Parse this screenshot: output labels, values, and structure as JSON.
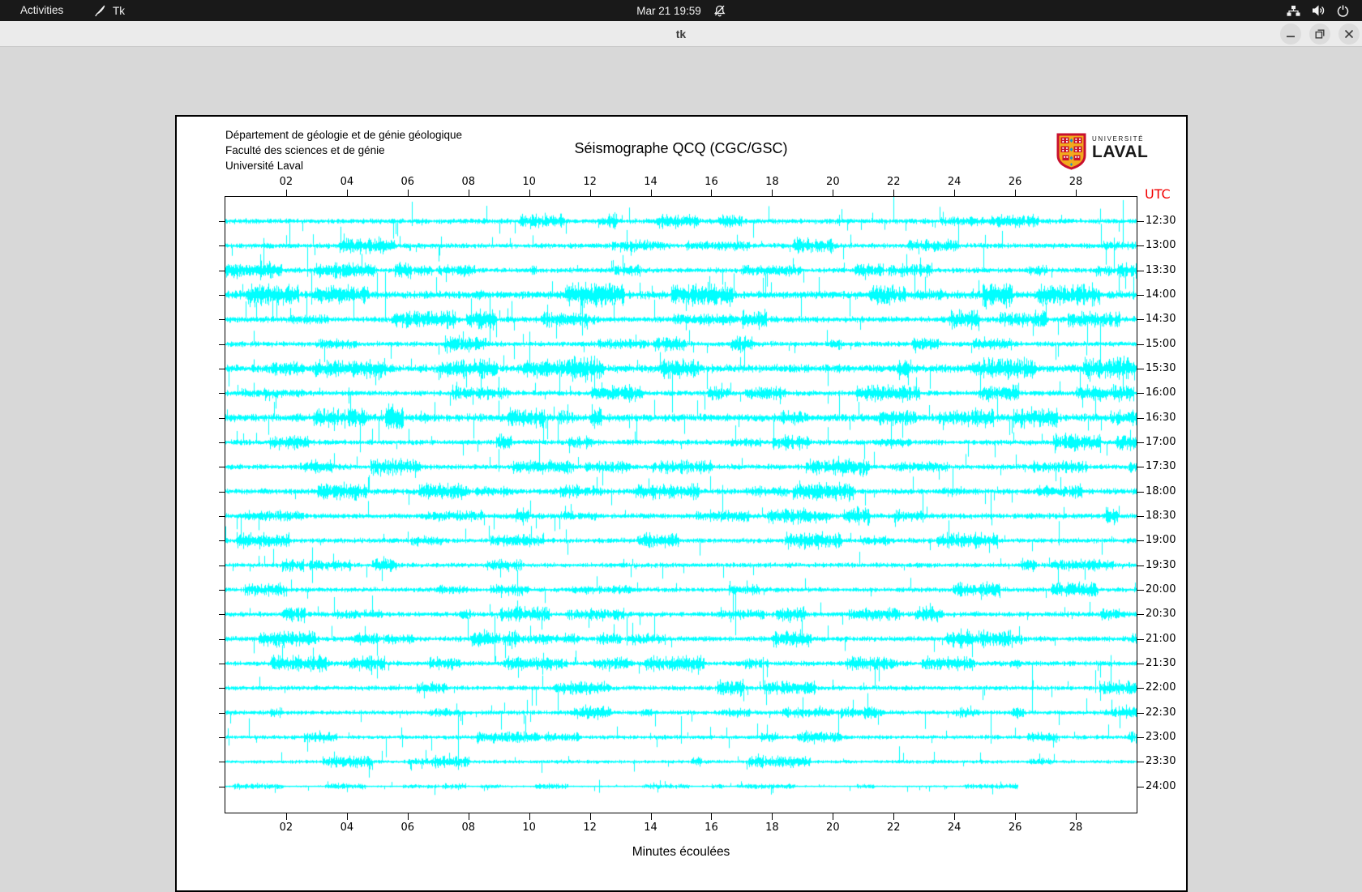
{
  "topbar": {
    "activities_label": "Activities",
    "app_name": "Tk",
    "clock": "Mar 21 19:59"
  },
  "window": {
    "title": "tk"
  },
  "header": {
    "org_lines": [
      "Département de géologie et de génie géologique",
      "Faculté des sciences et de génie",
      "Université Laval"
    ],
    "logo": {
      "top_text": "UNIVERSITÉ",
      "bottom_text": "LAVAL",
      "shield_red": "#c8102e",
      "shield_gold": "#f2aa1d",
      "shield_blue": "#1f8fcd"
    }
  },
  "chart_data": {
    "type": "line",
    "subtype": "seismogram-helicorder",
    "title": "Séismographe QCQ (CGC/GSC)",
    "xlabel": "Minutes écoulées",
    "x_tick_labels": [
      "02",
      "04",
      "06",
      "08",
      "10",
      "12",
      "14",
      "16",
      "18",
      "20",
      "22",
      "24",
      "26",
      "28"
    ],
    "x_range_minutes": [
      0,
      30
    ],
    "right_axis_title": "UTC",
    "right_axis_title_color": "#f20000",
    "trace_color": "#00ffff",
    "frame_color": "#000000",
    "rows": [
      {
        "utc": "12:30",
        "seed": 11,
        "amp": 1.0,
        "end": 1.0,
        "events": [
          {
            "x": 0.205,
            "up": 24,
            "down": 6
          },
          {
            "x": 0.985,
            "up": 26,
            "down": 26
          }
        ]
      },
      {
        "utc": "13:00",
        "seed": 12,
        "amp": 1.0,
        "end": 1.0,
        "events": [
          {
            "x": 0.975,
            "up": 10,
            "down": 34
          }
        ]
      },
      {
        "utc": "13:30",
        "seed": 13,
        "amp": 0.95,
        "end": 1.0,
        "events": [
          {
            "x": 0.09,
            "up": 30,
            "down": 8
          }
        ]
      },
      {
        "utc": "14:00",
        "seed": 14,
        "amp": 1.5,
        "end": 1.0,
        "events": [
          {
            "x": 0.175,
            "up": 28,
            "down": 28
          }
        ]
      },
      {
        "utc": "14:30",
        "seed": 15,
        "amp": 1.15,
        "end": 1.0,
        "events": [
          {
            "x": 0.27,
            "up": 26,
            "down": 10
          }
        ]
      },
      {
        "utc": "15:00",
        "seed": 16,
        "amp": 1.0,
        "end": 1.0,
        "events": [
          {
            "x": 0.96,
            "up": 30,
            "down": 30
          }
        ]
      },
      {
        "utc": "15:30",
        "seed": 17,
        "amp": 1.5,
        "end": 1.0,
        "events": []
      },
      {
        "utc": "16:00",
        "seed": 18,
        "amp": 1.0,
        "end": 1.0,
        "events": [
          {
            "x": 0.49,
            "up": 24,
            "down": 24
          }
        ]
      },
      {
        "utc": "16:30",
        "seed": 19,
        "amp": 1.45,
        "end": 1.0,
        "events": []
      },
      {
        "utc": "17:00",
        "seed": 20,
        "amp": 1.0,
        "end": 1.0,
        "events": [
          {
            "x": 0.73,
            "up": 26,
            "down": 8
          }
        ]
      },
      {
        "utc": "17:30",
        "seed": 21,
        "amp": 1.0,
        "end": 1.0,
        "events": [
          {
            "x": 0.3,
            "up": 22,
            "down": 6
          }
        ]
      },
      {
        "utc": "18:00",
        "seed": 22,
        "amp": 1.1,
        "end": 1.0,
        "events": [
          {
            "x": 0.545,
            "up": 8,
            "down": 26
          }
        ]
      },
      {
        "utc": "18:30",
        "seed": 23,
        "amp": 1.05,
        "end": 1.0,
        "events": [
          {
            "x": 0.765,
            "up": 28,
            "down": 8
          }
        ]
      },
      {
        "utc": "19:00",
        "seed": 24,
        "amp": 0.95,
        "end": 1.0,
        "events": [
          {
            "x": 0.915,
            "up": 24,
            "down": 6
          }
        ]
      },
      {
        "utc": "19:30",
        "seed": 25,
        "amp": 0.9,
        "end": 1.0,
        "events": [
          {
            "x": 0.095,
            "up": 22,
            "down": 22
          }
        ]
      },
      {
        "utc": "20:00",
        "seed": 26,
        "amp": 0.9,
        "end": 1.0,
        "events": [
          {
            "x": 0.32,
            "up": 24,
            "down": 8
          }
        ]
      },
      {
        "utc": "20:30",
        "seed": 27,
        "amp": 1.0,
        "end": 1.0,
        "events": [
          {
            "x": 0.56,
            "up": 26,
            "down": 26
          }
        ]
      },
      {
        "utc": "21:00",
        "seed": 28,
        "amp": 1.0,
        "end": 1.0,
        "events": [
          {
            "x": 0.295,
            "up": 28,
            "down": 28
          },
          {
            "x": 0.44,
            "up": 30,
            "down": 8
          }
        ]
      },
      {
        "utc": "21:30",
        "seed": 29,
        "amp": 0.95,
        "end": 1.0,
        "events": [
          {
            "x": 0.59,
            "up": 8,
            "down": 30
          }
        ]
      },
      {
        "utc": "22:00",
        "seed": 30,
        "amp": 0.9,
        "end": 1.0,
        "events": [
          {
            "x": 0.885,
            "up": 30,
            "down": 30
          },
          {
            "x": 0.955,
            "up": 22,
            "down": 6
          }
        ]
      },
      {
        "utc": "22:30",
        "seed": 31,
        "amp": 0.85,
        "end": 1.0,
        "events": [
          {
            "x": 0.705,
            "up": 24,
            "down": 6
          }
        ]
      },
      {
        "utc": "23:00",
        "seed": 32,
        "amp": 0.8,
        "end": 1.0,
        "events": [
          {
            "x": 0.5,
            "up": 26,
            "down": 8
          },
          {
            "x": 0.84,
            "up": 28,
            "down": 8
          }
        ]
      },
      {
        "utc": "23:30",
        "seed": 33,
        "amp": 0.7,
        "end": 1.0,
        "events": [
          {
            "x": 0.255,
            "up": 58,
            "down": 10
          }
        ]
      },
      {
        "utc": "24:00",
        "seed": 34,
        "amp": 0.35,
        "end": 0.87,
        "events": [
          {
            "x": 0.41,
            "up": 8,
            "down": 8
          }
        ]
      }
    ]
  }
}
